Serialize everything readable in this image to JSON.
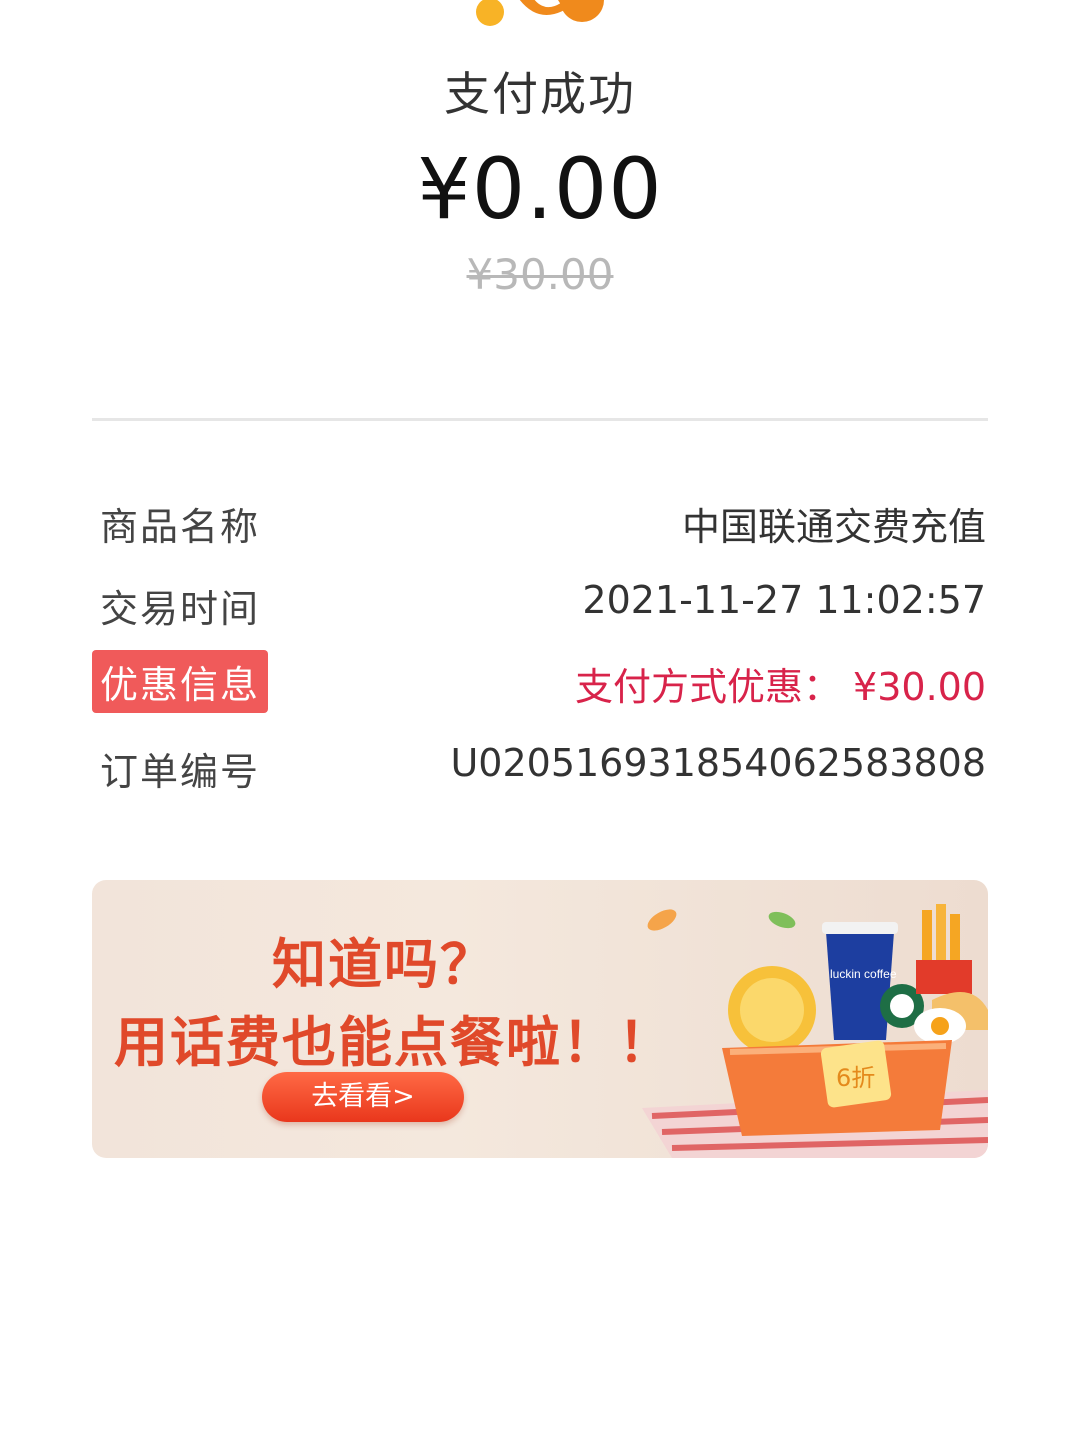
{
  "header": {
    "title": "支付成功",
    "amount": "¥0.00",
    "original_amount": "¥30.00"
  },
  "details": [
    {
      "label": "商品名称",
      "value": "中国联通交费充值"
    },
    {
      "label": "交易时间",
      "value": "2021-11-27 11:02:57"
    },
    {
      "label": "优惠信息",
      "value": "支付方式优惠：  ¥30.00"
    },
    {
      "label": "订单编号",
      "value": "U020516931854062583808"
    }
  ],
  "banner": {
    "line1": "知道吗？",
    "line2": "用话费也能点餐啦！！",
    "button": "去看看>",
    "cup_brand": "luckin coffee",
    "discount_tag": "6折"
  },
  "colors": {
    "accent_orange": "#f08a1c",
    "discount_red": "#d8234a",
    "badge_red": "#f05a5a",
    "banner_text": "#e0492a"
  }
}
